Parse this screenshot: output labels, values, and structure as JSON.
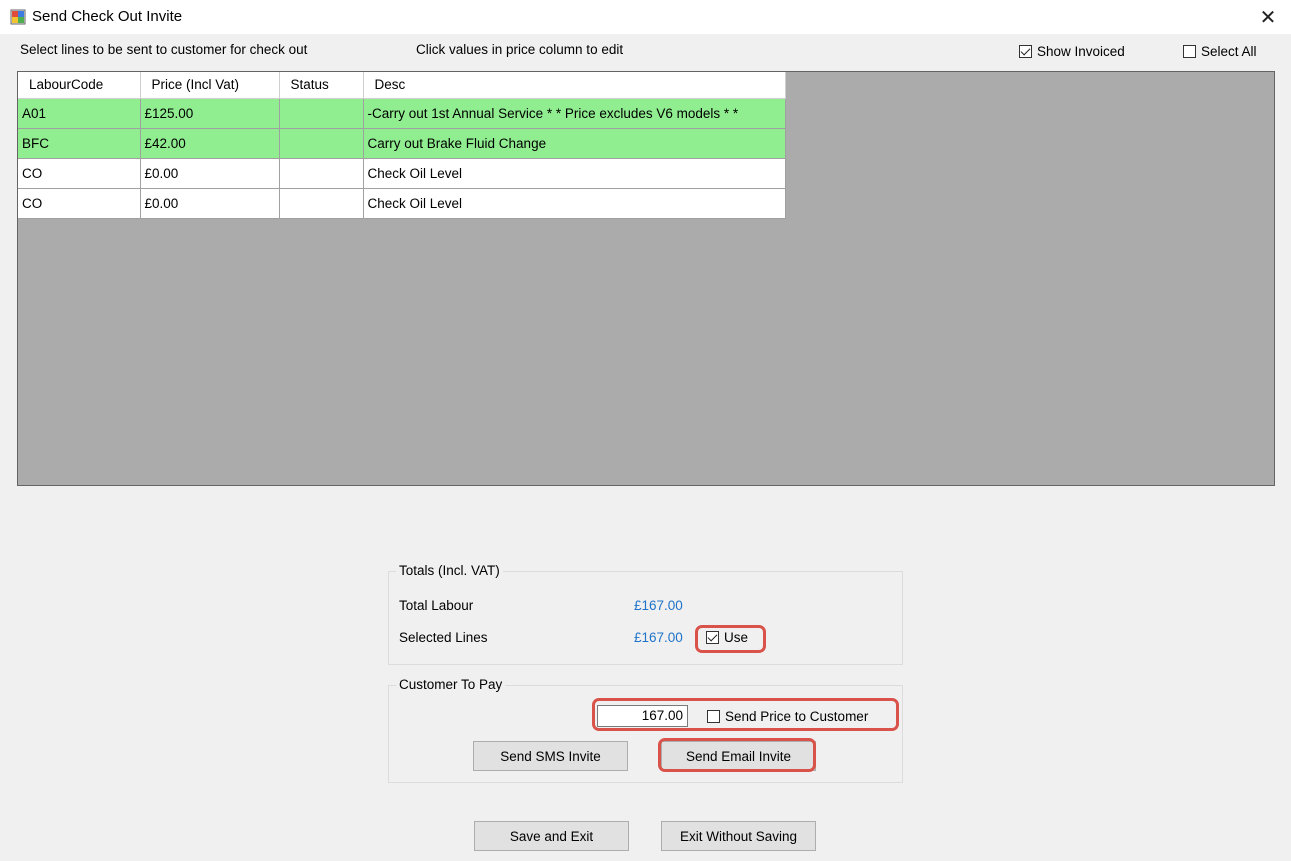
{
  "window": {
    "title": "Send Check Out Invite",
    "close_glyph": "✕"
  },
  "top": {
    "instruction": "Select lines to be sent to customer for check out",
    "hint": "Click values in price column to edit",
    "show_invoiced": {
      "label": "Show Invoiced",
      "checked": true
    },
    "select_all": {
      "label": "Select All",
      "checked": false
    }
  },
  "grid": {
    "columns": [
      "LabourCode",
      "Price (Incl Vat)",
      "Status",
      "Desc"
    ],
    "rows": [
      {
        "code": "A01",
        "price": "£125.00",
        "status": "",
        "desc": "-Carry out 1st Annual Service  * * Price excludes V6 models * *",
        "selected": true
      },
      {
        "code": "BFC",
        "price": "£42.00",
        "status": "",
        "desc": "Carry out Brake Fluid Change",
        "selected": true
      },
      {
        "code": "CO",
        "price": "£0.00",
        "status": "",
        "desc": "Check Oil Level",
        "selected": false
      },
      {
        "code": "CO",
        "price": "£0.00",
        "status": "",
        "desc": "Check Oil Level",
        "selected": false
      }
    ],
    "selected_row_color": "#90ee90"
  },
  "totals": {
    "title": "Totals (Incl. VAT)",
    "total_labour_label": "Total Labour",
    "total_labour_value": "£167.00",
    "selected_lines_label": "Selected Lines",
    "selected_lines_value": "£167.00",
    "use": {
      "label": "Use",
      "checked": true
    }
  },
  "customer": {
    "title": "Customer To Pay",
    "amount": "167.00",
    "send_price": {
      "label": "Send Price to Customer",
      "checked": false
    },
    "sms_button": "Send SMS Invite",
    "email_button": "Send Email Invite"
  },
  "footer": {
    "save_button": "Save and Exit",
    "exit_button": "Exit Without Saving"
  },
  "colors": {
    "value_blue": "#1e73c8",
    "highlight_red": "#d9534a"
  }
}
